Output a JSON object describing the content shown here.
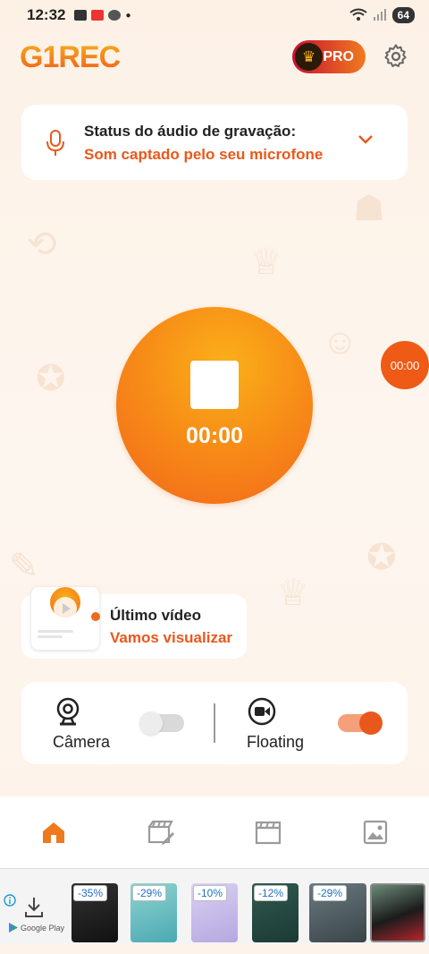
{
  "status_bar": {
    "time": "12:32",
    "battery": "64"
  },
  "header": {
    "logo": "G1REC",
    "pro_label": "PRO"
  },
  "audio_card": {
    "title": "Status do áudio de gravação:",
    "subtitle": "Som captado pelo seu microfone"
  },
  "record": {
    "timer": "00:00"
  },
  "floating_bubble": {
    "timer": "00:00"
  },
  "last_video": {
    "title": "Último vídeo",
    "subtitle": "Vamos visualizar"
  },
  "toggles": {
    "camera_label": "Câmera",
    "camera_on": false,
    "floating_label": "Floating",
    "floating_on": true
  },
  "bottom_nav": {
    "items": [
      {
        "icon": "home-icon",
        "active": true
      },
      {
        "icon": "video-edit-icon",
        "active": false
      },
      {
        "icon": "clapper-icon",
        "active": false
      },
      {
        "icon": "image-icon",
        "active": false
      }
    ]
  },
  "ad": {
    "store": "Google Play",
    "discounts": [
      "-35%",
      "-29%",
      "-10%",
      "-12%",
      "-29%"
    ]
  },
  "colors": {
    "accent": "#e9581b",
    "record_gradient_start": "#fbb01a",
    "record_gradient_end": "#f2661a",
    "background": "#fdf3ea"
  }
}
